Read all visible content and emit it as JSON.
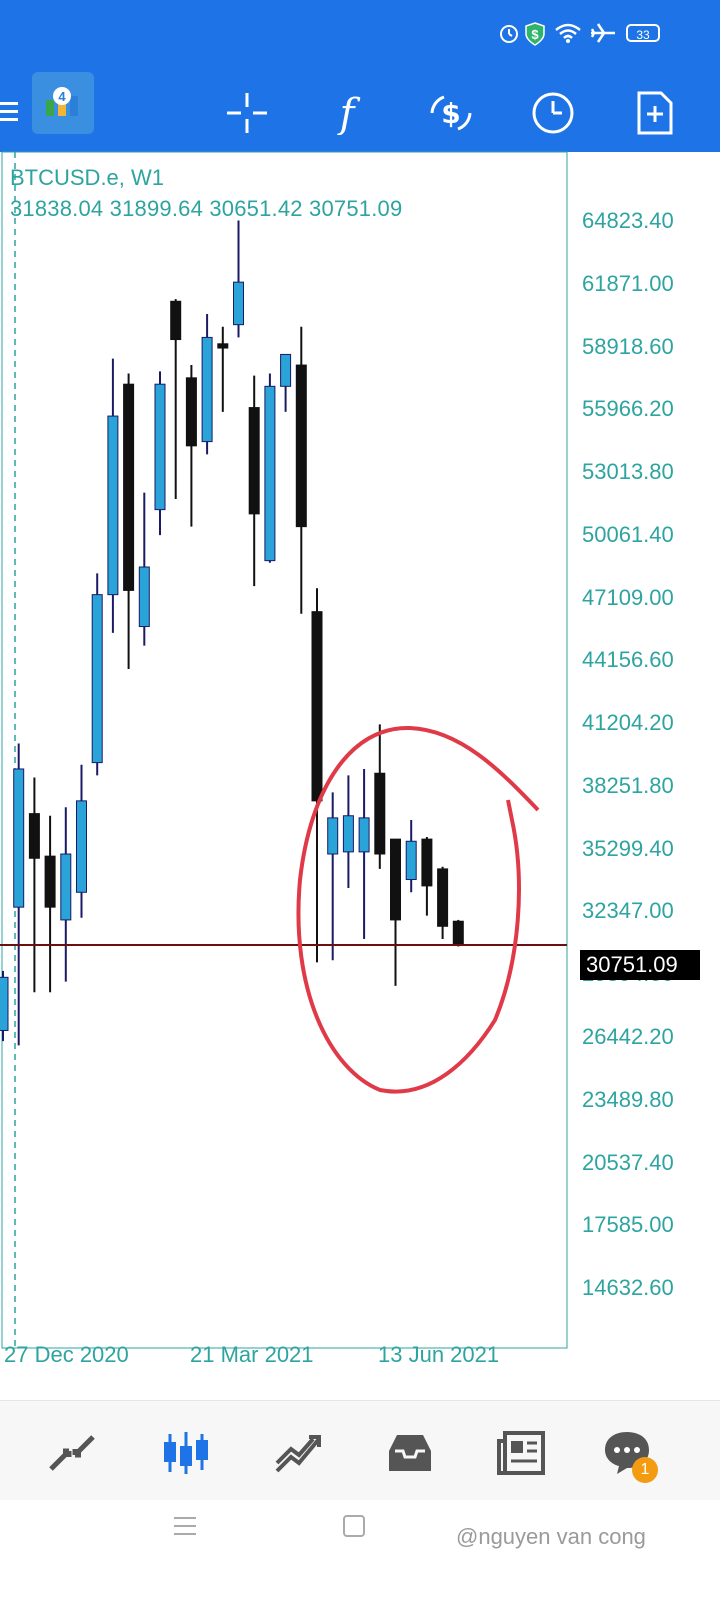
{
  "status_bar": {
    "battery": "33",
    "icons": [
      "alarm-icon",
      "shield-icon",
      "wifi-icon",
      "airplane-icon",
      "battery-icon"
    ]
  },
  "toolbar": {
    "icons": [
      "menu-icon",
      "app-logo",
      "crosshair-icon",
      "indicator-icon",
      "symbol-icon",
      "timeframe-icon",
      "new-order-icon"
    ]
  },
  "chart": {
    "symbol_label": "BTCUSD.e, W1",
    "ohlc_label": "31838.04 31899.64 30651.42 30751.09",
    "current_price_tag": "30751.09",
    "y_labels": [
      "64823.40",
      "61871.00",
      "58918.60",
      "55966.20",
      "53013.80",
      "50061.40",
      "47109.00",
      "44156.60",
      "41204.20",
      "38251.80",
      "35299.40",
      "32347.00",
      "29394.60",
      "26442.20",
      "23489.80",
      "20537.40",
      "17585.00",
      "14632.60"
    ],
    "x_labels": [
      "27 Dec 2020",
      "21 Mar 2021",
      "13 Jun 2021"
    ],
    "colors": {
      "bull": "#2aa3d8",
      "bear": "#111111",
      "price_line": "#6b1010",
      "axis_text": "#2ea4a0",
      "annotation": "#e03a48"
    }
  },
  "chart_data": {
    "type": "candlestick",
    "symbol": "BTCUSD.e",
    "timeframe": "W1",
    "last": {
      "open": 31838.04,
      "high": 31899.64,
      "low": 30651.42,
      "close": 30751.09
    },
    "ylim": [
      14632.6,
      64823.4
    ],
    "candles": [
      {
        "o": 26700,
        "h": 29500,
        "l": 26200,
        "c": 29200
      },
      {
        "o": 32500,
        "h": 40200,
        "l": 26000,
        "c": 39000
      },
      {
        "o": 36900,
        "h": 38600,
        "l": 28500,
        "c": 34800
      },
      {
        "o": 34900,
        "h": 36800,
        "l": 28500,
        "c": 32500
      },
      {
        "o": 31900,
        "h": 37200,
        "l": 29000,
        "c": 35000
      },
      {
        "o": 33200,
        "h": 39200,
        "l": 32000,
        "c": 37500
      },
      {
        "o": 39300,
        "h": 48200,
        "l": 38700,
        "c": 47200
      },
      {
        "o": 47200,
        "h": 58300,
        "l": 45400,
        "c": 55600
      },
      {
        "o": 57100,
        "h": 57600,
        "l": 43700,
        "c": 47400
      },
      {
        "o": 45700,
        "h": 52000,
        "l": 44800,
        "c": 48500
      },
      {
        "o": 51200,
        "h": 57700,
        "l": 50000,
        "c": 57100
      },
      {
        "o": 61000,
        "h": 61100,
        "l": 51700,
        "c": 59200
      },
      {
        "o": 57400,
        "h": 58000,
        "l": 50400,
        "c": 54200
      },
      {
        "o": 54400,
        "h": 60400,
        "l": 53800,
        "c": 59300
      },
      {
        "o": 59000,
        "h": 59800,
        "l": 55800,
        "c": 58800
      },
      {
        "o": 59900,
        "h": 64800,
        "l": 59300,
        "c": 61900
      },
      {
        "o": 56000,
        "h": 57500,
        "l": 47600,
        "c": 51000
      },
      {
        "o": 48800,
        "h": 57600,
        "l": 48700,
        "c": 57000
      },
      {
        "o": 57000,
        "h": 58400,
        "l": 55800,
        "c": 58500
      },
      {
        "o": 58000,
        "h": 59800,
        "l": 46300,
        "c": 50400
      },
      {
        "o": 46400,
        "h": 47500,
        "l": 29900,
        "c": 37500
      },
      {
        "o": 35000,
        "h": 37900,
        "l": 30000,
        "c": 36700
      },
      {
        "o": 35100,
        "h": 38700,
        "l": 33400,
        "c": 36800
      },
      {
        "o": 35100,
        "h": 39000,
        "l": 31000,
        "c": 36700
      },
      {
        "o": 38800,
        "h": 41100,
        "l": 34300,
        "c": 35000
      },
      {
        "o": 35700,
        "h": 35700,
        "l": 28800,
        "c": 31900
      },
      {
        "o": 33800,
        "h": 36600,
        "l": 33200,
        "c": 35600
      },
      {
        "o": 35700,
        "h": 35800,
        "l": 32100,
        "c": 33500
      },
      {
        "o": 34300,
        "h": 34400,
        "l": 31000,
        "c": 31600
      },
      {
        "o": 31838.04,
        "h": 31899.64,
        "l": 30651.42,
        "c": 30751.09
      }
    ]
  },
  "bottom_nav": {
    "items": [
      "quotes-icon",
      "chart-icon",
      "trade-icon",
      "history-icon",
      "news-icon",
      "messages-icon"
    ],
    "messages_badge": "1"
  },
  "watermark": "@nguyen van cong"
}
